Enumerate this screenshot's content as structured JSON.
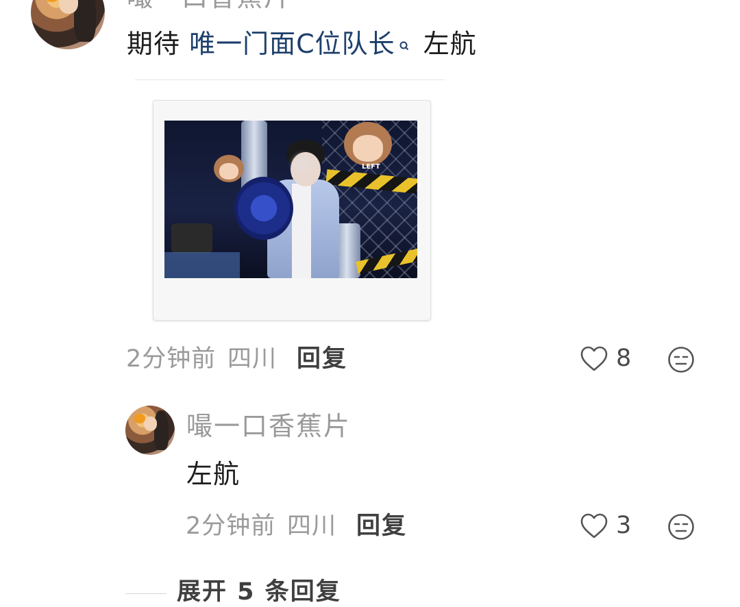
{
  "top_comment": {
    "username": "嘬一口香蕉片",
    "text_prefix": "期待 ",
    "mention": "唯一门面C位队长",
    "mention_icon": "search-icon",
    "text_suffix": " 左航",
    "time": "2分钟前",
    "location": "四川",
    "reply_label": "回复",
    "likes": "8",
    "image_text": "LEFT"
  },
  "reply": {
    "username": "嘬一口香蕉片",
    "text": "左航",
    "time": "2分钟前",
    "location": "四川",
    "reply_label": "回复",
    "likes": "3"
  },
  "expand": {
    "label": "展开 5 条回复"
  },
  "colors": {
    "mention": "#1d3f6b",
    "meta": "#9a9a9a"
  }
}
